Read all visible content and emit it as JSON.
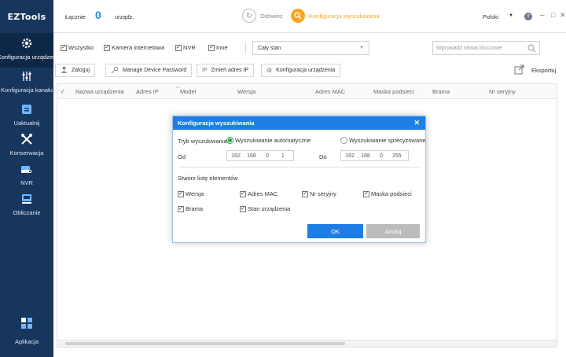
{
  "app": {
    "logo": "EZTools"
  },
  "sidebar": {
    "items": [
      {
        "label": "Konfiguracja urządzeń",
        "icon": "gear-icon"
      },
      {
        "label": "Konfiguracja kanału",
        "icon": "sliders-icon"
      },
      {
        "label": "Uaktualnij",
        "icon": "upgrade-icon"
      },
      {
        "label": "Konserwacja",
        "icon": "tools-icon"
      },
      {
        "label": "NVR",
        "icon": "nvr-icon"
      },
      {
        "label": "Obliczanie",
        "icon": "calculator-icon"
      },
      {
        "label": "Aplikacja",
        "icon": "apps-icon"
      }
    ]
  },
  "topbar": {
    "count_label": "Łącznie",
    "count_value": "0",
    "count_unit": "urządz.",
    "refresh_label": "Odśwież",
    "search_config_label": "Konfiguracja wyszukiwania",
    "language": "Polski"
  },
  "filters": {
    "all": "Wszystko",
    "ipc": "Kamera internetowa",
    "nvr": "NVR",
    "other": "Inne",
    "state_select": "Cały stan",
    "search_placeholder": "Wprowadź słowa kluczowe"
  },
  "toolbar": {
    "login": "Zaloguj",
    "manage_password": "Manage Device Password",
    "change_ip": "Zmień adres IP",
    "device_config": "Konfiguracja urządzenia",
    "export": "Eksportuj"
  },
  "table": {
    "columns": [
      "√",
      "Nazwa urządzenia",
      "Adres IP",
      "Model",
      "Wersja",
      "Adres MAC",
      "Maska podsieci",
      "Brama",
      "Nr seryjny"
    ]
  },
  "modal": {
    "title": "Konfiguracja wyszukiwania",
    "mode_label": "Tryb wyszukiwania",
    "mode_auto": "Wyszukiwanie automatyczne",
    "mode_specific": "Wyszukiwanie sprecyzowane",
    "from_label": "Od",
    "to_label": "Do",
    "from_ip": [
      "192",
      "168",
      "0",
      "1"
    ],
    "to_ip": [
      "192",
      "168",
      "0",
      "255"
    ],
    "list_label": "Stwórz listę elementów",
    "items": {
      "version": "Wersja",
      "mac": "Adres MAC",
      "serial": "Nr seryjny",
      "mask": "Maska podsieci",
      "gateway": "Brama",
      "state": "Stan urządzenia"
    },
    "ok": "OK",
    "cancel": "Anuluj"
  },
  "colors": {
    "sidebar": "#17365d",
    "accent": "#1e7ee6",
    "orange": "#f5a623",
    "radio_on": "#2e9e45"
  }
}
